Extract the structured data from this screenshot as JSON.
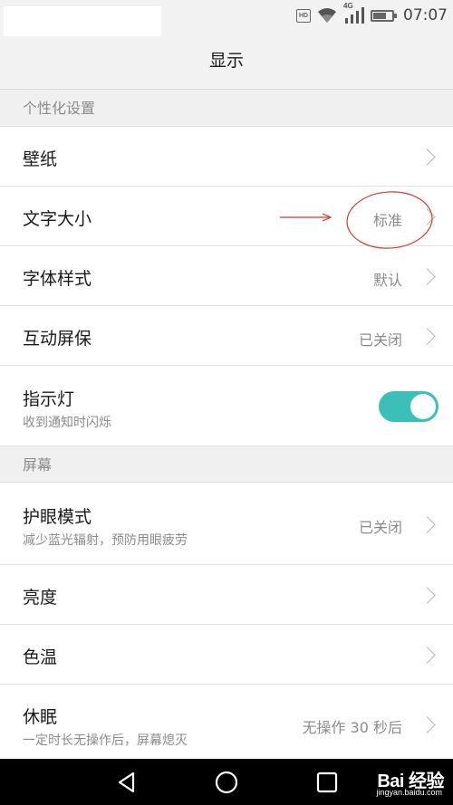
{
  "status": {
    "hd": "HD",
    "network": "4G",
    "time": "07:07",
    "battery_level": 0.7
  },
  "header": {
    "title": "显示"
  },
  "sections": {
    "personal": "个性化设置",
    "screen": "屏幕"
  },
  "rows": {
    "wallpaper": {
      "title": "壁纸"
    },
    "font_size": {
      "title": "文字大小",
      "value": "标准"
    },
    "font_style": {
      "title": "字体样式",
      "value": "默认"
    },
    "screensaver": {
      "title": "互动屏保",
      "value": "已关闭"
    },
    "indicator": {
      "title": "指示灯",
      "sub": "收到通知时闪烁",
      "toggle_on": true
    },
    "eye_care": {
      "title": "护眼模式",
      "sub": "减少蓝光辐射，预防用眼疲劳",
      "value": "已关闭"
    },
    "brightness": {
      "title": "亮度"
    },
    "color_temp": {
      "title": "色温"
    },
    "sleep": {
      "title": "休眠",
      "sub": "一定时长无操作后，屏幕熄灭",
      "value": "无操作 30 秒后"
    }
  },
  "colors": {
    "accent": "#3dbfb9",
    "annotation": "#d23a2e"
  },
  "navbar": {
    "icons": [
      "back-icon",
      "home-icon",
      "recents-icon"
    ],
    "watermark": "Bai 经验",
    "watermark_sub": "jingyan.baidu.com"
  }
}
